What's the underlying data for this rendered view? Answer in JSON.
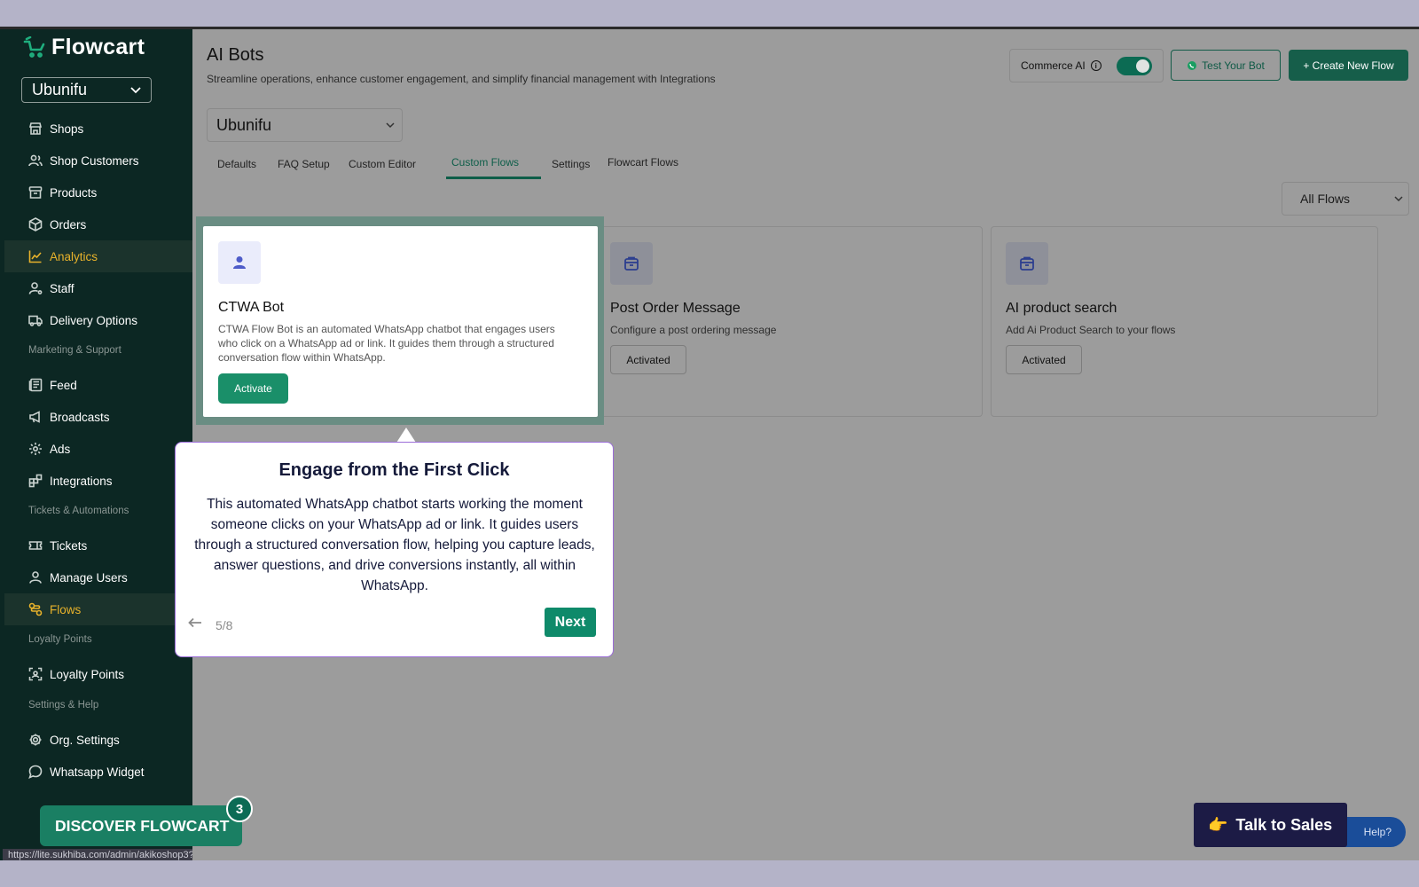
{
  "brand": {
    "name": "Flowcart",
    "accent": "#1a8f69",
    "sidebar_bg": "#0c2723",
    "active_color": "#e8b22b"
  },
  "sidebar": {
    "shop_selector": "Ubunifu",
    "items": [
      {
        "label": "Shops",
        "icon": "store-icon"
      },
      {
        "label": "Shop Customers",
        "icon": "users-icon"
      },
      {
        "label": "Products",
        "icon": "archive-icon"
      },
      {
        "label": "Orders",
        "icon": "package-icon"
      },
      {
        "label": "Analytics",
        "icon": "line-chart-icon",
        "active": true
      },
      {
        "label": "Staff",
        "icon": "user-cog-icon"
      },
      {
        "label": "Delivery Options",
        "icon": "truck-icon"
      },
      {
        "label": "Feed",
        "icon": "newspaper-icon"
      },
      {
        "label": "Broadcasts",
        "icon": "megaphone-icon"
      },
      {
        "label": "Ads",
        "icon": "sparkle-icon"
      },
      {
        "label": "Integrations",
        "icon": "blocks-icon"
      },
      {
        "label": "Tickets",
        "icon": "ticket-icon"
      },
      {
        "label": "Manage Users",
        "icon": "user-icon"
      },
      {
        "label": "Flows",
        "icon": "workflow-icon",
        "active": true
      },
      {
        "label": "Loyalty Points",
        "icon": "scan-icon"
      },
      {
        "label": "Org. Settings",
        "icon": "gear-icon"
      },
      {
        "label": "Whatsapp Widget",
        "icon": "chat-icon"
      }
    ],
    "sections": [
      "Marketing & Support",
      "Tickets & Automations",
      "Loyalty Points",
      "Settings & Help"
    ],
    "discover_label": "DISCOVER FLOWCART",
    "discover_badge": "3",
    "status_url": "https://lite.sukhiba.com/admin/akikoshop3?tab=Analytics"
  },
  "header": {
    "title": "AI Bots",
    "subtitle": "Streamline operations, enhance customer engagement, and simplify financial management with Integrations",
    "commerce_ai_label": "Commerce AI",
    "commerce_ai_on": true,
    "test_bot_label": "Test Your Bot",
    "create_flow_label": "+ Create New Flow"
  },
  "store_select": "Ubunifu",
  "tabs": [
    {
      "label": "Defaults"
    },
    {
      "label": "FAQ Setup"
    },
    {
      "label": "Custom Editor"
    },
    {
      "label": "Custom Flows",
      "active": true
    },
    {
      "label": "Settings"
    },
    {
      "label": "Flowcart Flows"
    }
  ],
  "filter_select": "All Flows",
  "cards": [
    {
      "title": "CTWA Bot",
      "description": "CTWA Flow Bot is an automated WhatsApp chatbot that engages users who click on a WhatsApp ad or link. It guides them through a structured conversation flow within WhatsApp.",
      "button": "Activate",
      "icon": "user-icon"
    },
    {
      "title": "Post Order Message",
      "description": "Configure a post ordering message",
      "button": "Activated",
      "icon": "bag-icon"
    },
    {
      "title": "AI product search",
      "description": "Add Ai Product Search to your flows",
      "button": "Activated",
      "icon": "bag-icon"
    }
  ],
  "tour": {
    "title": "Engage from the First Click",
    "body": "This automated WhatsApp chatbot starts working the moment someone clicks on your WhatsApp ad or link. It guides users through a structured conversation flow, helping you capture leads, answer questions, and drive conversions instantly, all within WhatsApp.",
    "step": "5/8",
    "next_label": "Next"
  },
  "floating": {
    "talk_to_sales": "Talk to Sales",
    "talk_emoji": "👉",
    "help_label": "Help?"
  }
}
